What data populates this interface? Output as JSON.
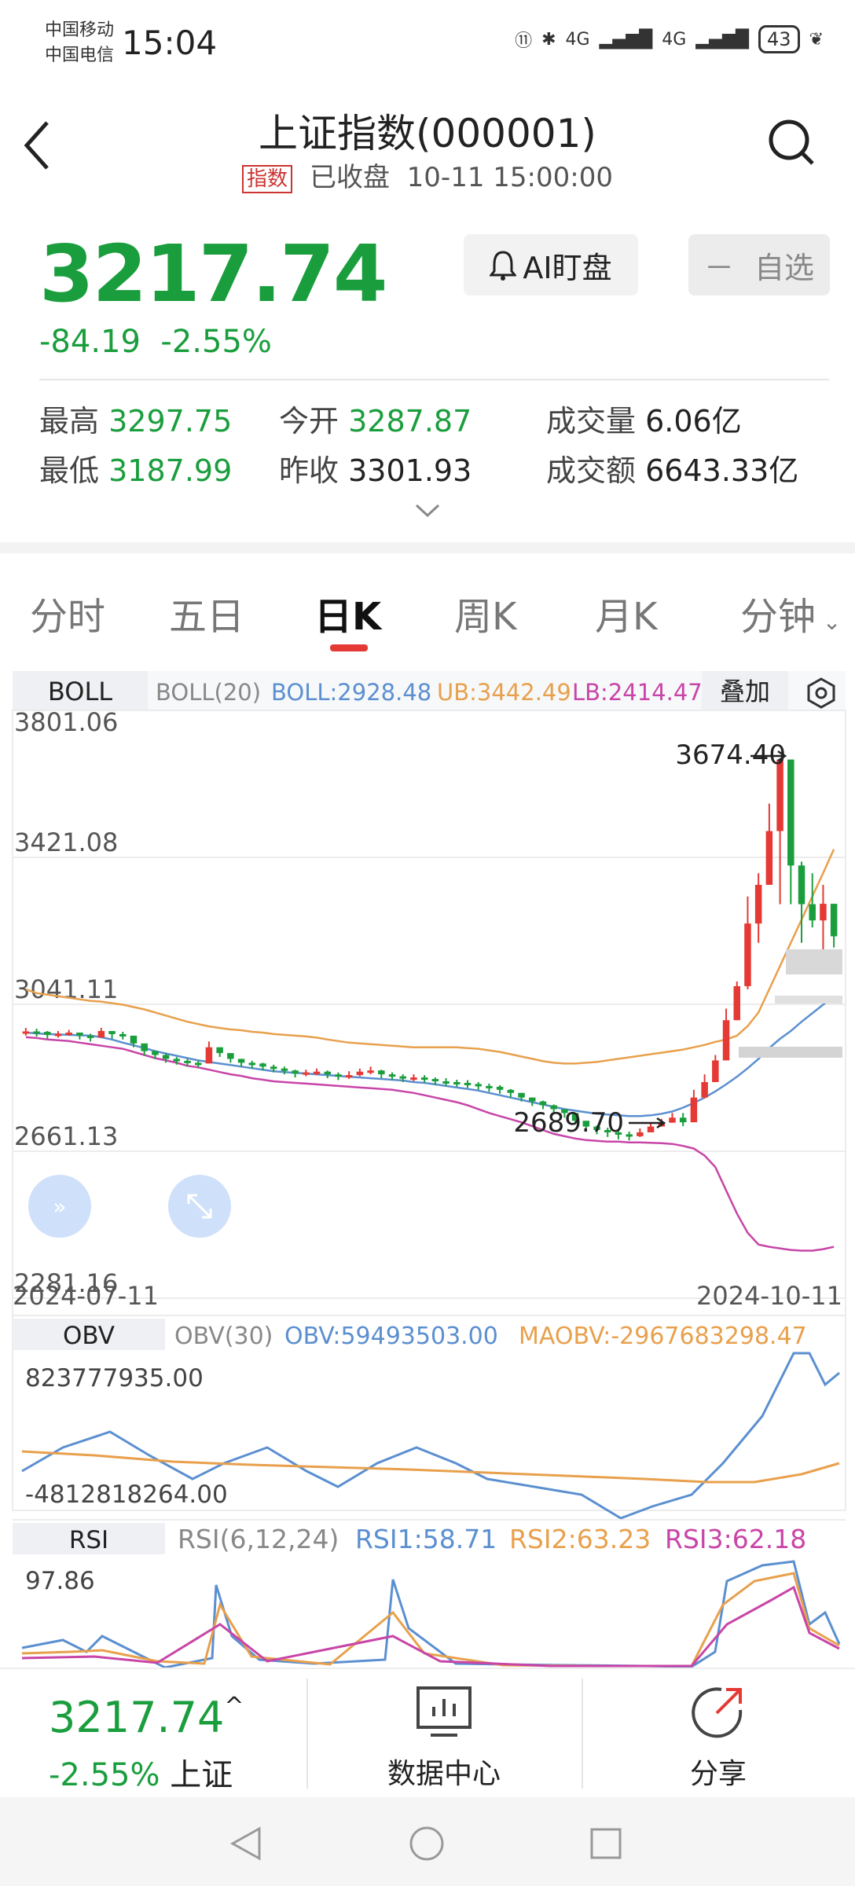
{
  "status": {
    "carrier1": "中国移动",
    "carrier2": "中国电信",
    "time": "15:04",
    "battery": "43",
    "net1": "4G",
    "net2": "4G"
  },
  "header": {
    "title": "上证指数(000001)",
    "tag": "指数",
    "status": "已收盘",
    "datetime": "10-11 15:00:00"
  },
  "quote": {
    "price": "3217.74",
    "change": "-84.19",
    "change_pct": "-2.55%"
  },
  "buttons": {
    "ai": "AI盯盘",
    "watch_icon": "－",
    "watch": "自选"
  },
  "stats": {
    "high_label": "最高",
    "high": "3297.75",
    "low_label": "最低",
    "low": "3187.99",
    "open_label": "今开",
    "open": "3287.87",
    "prevclose_label": "昨收",
    "prevclose": "3301.93",
    "volume_label": "成交量",
    "volume": "6.06亿",
    "amount_label": "成交额",
    "amount": "6643.33亿"
  },
  "tabs": [
    "分时",
    "五日",
    "日K",
    "周K",
    "月K",
    "分钟"
  ],
  "boll": {
    "name": "BOLL",
    "params": "BOLL(20)",
    "boll": "BOLL:2928.48",
    "ub": "UB:3442.49",
    "lb": "LB:2414.47",
    "overlay": "叠加"
  },
  "kline": {
    "y_ticks": [
      "3801.06",
      "3421.08",
      "3041.11",
      "2661.13",
      "2281.16"
    ],
    "x_start": "2024-07-11",
    "x_end": "2024-10-11",
    "max_label": "3674.40",
    "min_label": "2689.70",
    "colors": {
      "up": "#e53935",
      "down": "#1a9e3d",
      "boll": "#5b8fd0",
      "ub": "#e8a04c",
      "lb": "#c845a8"
    }
  },
  "obv": {
    "name": "OBV",
    "params": "OBV(30)",
    "obv": "OBV:59493503.00",
    "maobv": "MAOBV:-2967683298.47",
    "ticks": [
      "823777935.00",
      "-4812818264.00"
    ]
  },
  "rsi": {
    "name": "RSI",
    "params": "RSI(6,12,24)",
    "rsi1": "RSI1:58.71",
    "rsi2": "RSI2:63.23",
    "rsi3": "RSI3:62.18",
    "ticks": [
      "97.86"
    ]
  },
  "bottom": {
    "price": "3217.74",
    "arrow": "^",
    "pct": "-2.55%",
    "name": "上证",
    "data_center": "数据中心",
    "share": "分享"
  },
  "chart_data": {
    "type": "candlestick",
    "x_range": [
      "2024-07-11",
      "2024-10-11"
    ],
    "ylim": [
      2281.16,
      3801.06
    ],
    "close": [
      2971,
      2970,
      2962,
      2965,
      2968,
      2960,
      2955,
      2972,
      2964,
      2960,
      2940,
      2920,
      2910,
      2900,
      2895,
      2890,
      2888,
      2930,
      2915,
      2900,
      2890,
      2888,
      2880,
      2875,
      2870,
      2862,
      2865,
      2867,
      2860,
      2855,
      2858,
      2867,
      2870,
      2860,
      2855,
      2850,
      2852,
      2848,
      2842,
      2840,
      2838,
      2835,
      2830,
      2828,
      2820,
      2812,
      2800,
      2790,
      2780,
      2770,
      2760,
      2740,
      2725,
      2716,
      2710,
      2705,
      2700,
      2710,
      2725,
      2735,
      2748,
      2736,
      2800,
      2840,
      2896,
      3000,
      3088,
      3250,
      3350,
      3489,
      3674,
      3400,
      3300,
      3258,
      3301,
      3217
    ],
    "high": [
      2980,
      2978,
      2972,
      2972,
      2975,
      2968,
      2965,
      2980,
      2972,
      2970,
      2955,
      2935,
      2922,
      2915,
      2905,
      2900,
      2895,
      2945,
      2930,
      2915,
      2900,
      2895,
      2890,
      2885,
      2880,
      2872,
      2872,
      2875,
      2870,
      2865,
      2868,
      2875,
      2880,
      2872,
      2865,
      2860,
      2860,
      2858,
      2852,
      2850,
      2846,
      2845,
      2840,
      2836,
      2832,
      2822,
      2812,
      2800,
      2792,
      2782,
      2770,
      2752,
      2735,
      2728,
      2722,
      2715,
      2712,
      2720,
      2735,
      2745,
      2760,
      2760,
      2820,
      2860,
      2910,
      3030,
      3100,
      3320,
      3380,
      3560,
      3674,
      3500,
      3410,
      3380,
      3350,
      3297
    ],
    "low": [
      2960,
      2958,
      2952,
      2955,
      2960,
      2950,
      2945,
      2962,
      2952,
      2950,
      2930,
      2908,
      2900,
      2890,
      2885,
      2880,
      2878,
      2900,
      2905,
      2890,
      2880,
      2875,
      2870,
      2865,
      2860,
      2852,
      2855,
      2858,
      2850,
      2845,
      2848,
      2855,
      2860,
      2850,
      2845,
      2840,
      2842,
      2838,
      2832,
      2830,
      2828,
      2825,
      2820,
      2815,
      2810,
      2800,
      2790,
      2778,
      2770,
      2760,
      2748,
      2730,
      2715,
      2705,
      2698,
      2692,
      2689,
      2698,
      2712,
      2725,
      2735,
      2726,
      2740,
      2798,
      2840,
      2905,
      3000,
      3080,
      3200,
      3350,
      3300,
      3300,
      3200,
      3240,
      3180,
      3188
    ],
    "boll_mid": [
      2968,
      2966,
      2964,
      2963,
      2962,
      2961,
      2960,
      2956,
      2950,
      2942,
      2935,
      2928,
      2920,
      2914,
      2908,
      2902,
      2896,
      2892,
      2888,
      2884,
      2880,
      2876,
      2872,
      2868,
      2866,
      2864,
      2862,
      2860,
      2858,
      2856,
      2854,
      2852,
      2850,
      2848,
      2846,
      2844,
      2840,
      2838,
      2834,
      2830,
      2826,
      2822,
      2818,
      2812,
      2806,
      2800,
      2794,
      2788,
      2782,
      2776,
      2770,
      2766,
      2762,
      2758,
      2756,
      2754,
      2752,
      2752,
      2754,
      2758,
      2764,
      2774,
      2786,
      2800,
      2816,
      2834,
      2854,
      2876,
      2900,
      2928,
      2952,
      2972,
      2996,
      3018,
      3040,
      3062
    ],
    "boll_ub": [
      3080,
      3070,
      3066,
      3062,
      3058,
      3054,
      3050,
      3048,
      3044,
      3040,
      3034,
      3028,
      3020,
      3012,
      3004,
      2996,
      2990,
      2984,
      2980,
      2976,
      2974,
      2970,
      2968,
      2964,
      2962,
      2960,
      2958,
      2955,
      2950,
      2946,
      2942,
      2940,
      2938,
      2936,
      2934,
      2932,
      2930,
      2930,
      2930,
      2930,
      2930,
      2928,
      2926,
      2922,
      2918,
      2912,
      2906,
      2900,
      2894,
      2890,
      2888,
      2888,
      2890,
      2892,
      2896,
      2900,
      2904,
      2908,
      2912,
      2916,
      2920,
      2924,
      2930,
      2936,
      2944,
      2950,
      2960,
      2985,
      3020,
      3080,
      3140,
      3200,
      3260,
      3320,
      3380,
      3442
    ],
    "boll_lb": [
      2956,
      2954,
      2950,
      2948,
      2946,
      2942,
      2938,
      2934,
      2930,
      2926,
      2918,
      2910,
      2902,
      2896,
      2890,
      2882,
      2878,
      2872,
      2866,
      2860,
      2856,
      2850,
      2846,
      2842,
      2840,
      2838,
      2836,
      2834,
      2832,
      2830,
      2828,
      2826,
      2824,
      2822,
      2820,
      2816,
      2812,
      2806,
      2800,
      2794,
      2788,
      2780,
      2770,
      2760,
      2752,
      2744,
      2736,
      2726,
      2716,
      2706,
      2700,
      2694,
      2690,
      2688,
      2686,
      2686,
      2684,
      2684,
      2683,
      2682,
      2680,
      2675,
      2668,
      2650,
      2620,
      2560,
      2500,
      2450,
      2420,
      2414,
      2410,
      2406,
      2404,
      2404,
      2408,
      2414
    ]
  }
}
